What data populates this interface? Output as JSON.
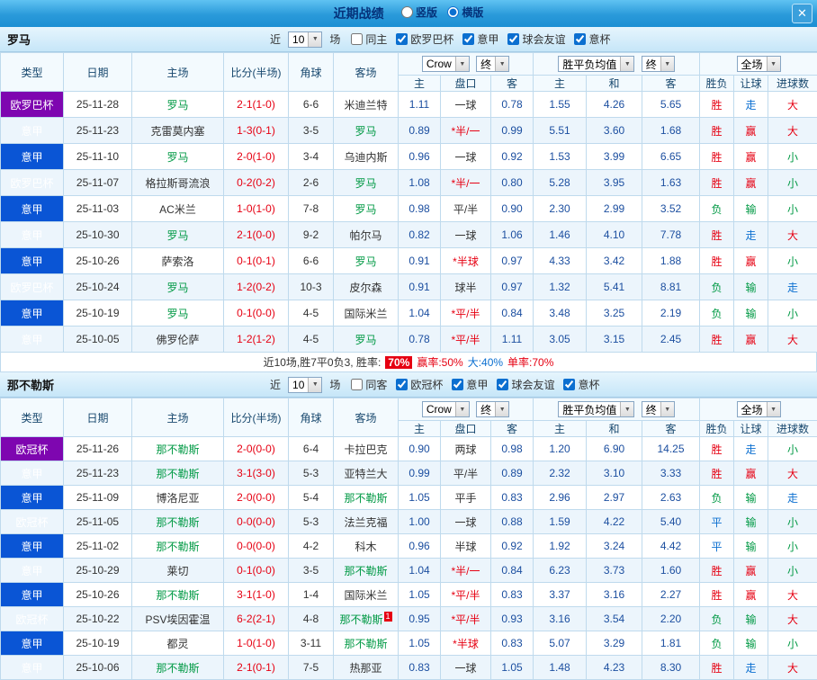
{
  "titlebar": {
    "title": "近期战绩",
    "radio_vertical": "竖版",
    "radio_horizontal": "横版",
    "selected": "横版",
    "close_icon": "✕"
  },
  "table": {
    "col_type": "类型",
    "col_date": "日期",
    "col_home": "主场",
    "col_score": "比分(半场)",
    "col_corner": "角球",
    "col_away": "客场",
    "sub_home": "主",
    "sub_handicap": "盘口",
    "sub_away": "客",
    "sub_avg_home": "主",
    "sub_avg_draw": "和",
    "sub_avg_away": "客",
    "sub_result": "胜负",
    "sub_spread": "让球",
    "sub_goals": "进球数",
    "dd_company": "Crow",
    "dd_final": "终",
    "dd_avg": "胜平负均值",
    "dd_scope": "全场"
  },
  "sections": [
    {
      "team": "罗马",
      "near_label": "近",
      "count": "10",
      "games_label": "场",
      "filters": [
        {
          "label": "同主",
          "checked": false
        },
        {
          "label": "欧罗巴杯",
          "checked": true
        },
        {
          "label": "意甲",
          "checked": true
        },
        {
          "label": "球会友谊",
          "checked": true
        },
        {
          "label": "意杯",
          "checked": true
        }
      ],
      "rows": [
        {
          "comp": "欧罗巴杯",
          "comp_color": "purple",
          "date": "25-11-28",
          "home": "罗马",
          "home_focus": true,
          "score": "2-1(1-0)",
          "corners": "6-6",
          "away": "米迪兰特",
          "odds_home": "1.11",
          "handicap": "一球",
          "odds_away": "0.78",
          "avg_home": "1.55",
          "avg_draw": "4.26",
          "avg_away": "5.65",
          "result": "胜",
          "spread": "走",
          "goals": "大"
        },
        {
          "comp": "意甲",
          "comp_color": "blue",
          "date": "25-11-23",
          "home": "克雷莫内塞",
          "score": "1-3(0-1)",
          "corners": "3-5",
          "away": "罗马",
          "away_focus": true,
          "odds_home": "0.89",
          "handicap": "*半/一",
          "odds_away": "0.99",
          "avg_home": "5.51",
          "avg_draw": "3.60",
          "avg_away": "1.68",
          "result": "胜",
          "spread": "赢",
          "goals": "大"
        },
        {
          "comp": "意甲",
          "comp_color": "blue",
          "date": "25-11-10",
          "home": "罗马",
          "home_focus": true,
          "score": "2-0(1-0)",
          "corners": "3-4",
          "away": "乌迪内斯",
          "odds_home": "0.96",
          "handicap": "一球",
          "odds_away": "0.92",
          "avg_home": "1.53",
          "avg_draw": "3.99",
          "avg_away": "6.65",
          "result": "胜",
          "spread": "赢",
          "goals": "小"
        },
        {
          "comp": "欧罗巴杯",
          "comp_color": "purple",
          "date": "25-11-07",
          "home": "格拉斯哥流浪",
          "score": "0-2(0-2)",
          "corners": "2-6",
          "away": "罗马",
          "away_focus": true,
          "odds_home": "1.08",
          "handicap": "*半/一",
          "odds_away": "0.80",
          "avg_home": "5.28",
          "avg_draw": "3.95",
          "avg_away": "1.63",
          "result": "胜",
          "spread": "赢",
          "goals": "小"
        },
        {
          "comp": "意甲",
          "comp_color": "blue",
          "date": "25-11-03",
          "home": "AC米兰",
          "score": "1-0(1-0)",
          "corners": "7-8",
          "away": "罗马",
          "away_focus": true,
          "odds_home": "0.98",
          "handicap": "平/半",
          "odds_away": "0.90",
          "avg_home": "2.30",
          "avg_draw": "2.99",
          "avg_away": "3.52",
          "result": "负",
          "spread": "输",
          "goals": "小"
        },
        {
          "comp": "意甲",
          "comp_color": "blue",
          "date": "25-10-30",
          "home": "罗马",
          "home_focus": true,
          "score": "2-1(0-0)",
          "corners": "9-2",
          "away": "帕尔马",
          "odds_home": "0.82",
          "handicap": "一球",
          "odds_away": "1.06",
          "avg_home": "1.46",
          "avg_draw": "4.10",
          "avg_away": "7.78",
          "result": "胜",
          "spread": "走",
          "goals": "大"
        },
        {
          "comp": "意甲",
          "comp_color": "blue",
          "date": "25-10-26",
          "home": "萨索洛",
          "score": "0-1(0-1)",
          "corners": "6-6",
          "away": "罗马",
          "away_focus": true,
          "odds_home": "0.91",
          "handicap": "*半球",
          "odds_away": "0.97",
          "avg_home": "4.33",
          "avg_draw": "3.42",
          "avg_away": "1.88",
          "result": "胜",
          "spread": "赢",
          "goals": "小"
        },
        {
          "comp": "欧罗巴杯",
          "comp_color": "purple",
          "date": "25-10-24",
          "home": "罗马",
          "home_focus": true,
          "score": "1-2(0-2)",
          "corners": "10-3",
          "away": "皮尔森",
          "odds_home": "0.91",
          "handicap": "球半",
          "odds_away": "0.97",
          "avg_home": "1.32",
          "avg_draw": "5.41",
          "avg_away": "8.81",
          "result": "负",
          "spread": "输",
          "goals": "走"
        },
        {
          "comp": "意甲",
          "comp_color": "blue",
          "date": "25-10-19",
          "home": "罗马",
          "home_focus": true,
          "score": "0-1(0-0)",
          "corners": "4-5",
          "away": "国际米兰",
          "odds_home": "1.04",
          "handicap": "*平/半",
          "odds_away": "0.84",
          "avg_home": "3.48",
          "avg_draw": "3.25",
          "avg_away": "2.19",
          "result": "负",
          "spread": "输",
          "goals": "小"
        },
        {
          "comp": "意甲",
          "comp_color": "blue",
          "date": "25-10-05",
          "home": "佛罗伦萨",
          "score": "1-2(1-2)",
          "corners": "4-5",
          "away": "罗马",
          "away_focus": true,
          "odds_home": "0.78",
          "handicap": "*平/半",
          "odds_away": "1.11",
          "avg_home": "3.05",
          "avg_draw": "3.15",
          "avg_away": "2.45",
          "result": "胜",
          "spread": "赢",
          "goals": "大"
        }
      ],
      "summary": {
        "prefix": "近10场,胜7平0负3, 胜率:",
        "win_rate": "70%",
        "win_odds_rate": "赢率:50%",
        "big_rate": "大:40%",
        "single_rate": "单率:70%"
      }
    },
    {
      "team": "那不勒斯",
      "near_label": "近",
      "count": "10",
      "games_label": "场",
      "filters": [
        {
          "label": "同客",
          "checked": false
        },
        {
          "label": "欧冠杯",
          "checked": true
        },
        {
          "label": "意甲",
          "checked": true
        },
        {
          "label": "球会友谊",
          "checked": true
        },
        {
          "label": "意杯",
          "checked": true
        }
      ],
      "rows": [
        {
          "comp": "欧冠杯",
          "comp_color": "purple",
          "date": "25-11-26",
          "home": "那不勒斯",
          "home_focus": true,
          "score": "2-0(0-0)",
          "corners": "6-4",
          "away": "卡拉巴克",
          "odds_home": "0.90",
          "handicap": "两球",
          "odds_away": "0.98",
          "avg_home": "1.20",
          "avg_draw": "6.90",
          "avg_away": "14.25",
          "result": "胜",
          "spread": "走",
          "goals": "小"
        },
        {
          "comp": "意甲",
          "comp_color": "blue",
          "date": "25-11-23",
          "home": "那不勒斯",
          "home_focus": true,
          "score": "3-1(3-0)",
          "corners": "5-3",
          "away": "亚特兰大",
          "odds_home": "0.99",
          "handicap": "平/半",
          "odds_away": "0.89",
          "avg_home": "2.32",
          "avg_draw": "3.10",
          "avg_away": "3.33",
          "result": "胜",
          "spread": "赢",
          "goals": "大"
        },
        {
          "comp": "意甲",
          "comp_color": "blue",
          "date": "25-11-09",
          "home": "博洛尼亚",
          "score": "2-0(0-0)",
          "corners": "5-4",
          "away": "那不勒斯",
          "away_focus": true,
          "odds_home": "1.05",
          "handicap": "平手",
          "odds_away": "0.83",
          "avg_home": "2.96",
          "avg_draw": "2.97",
          "avg_away": "2.63",
          "result": "负",
          "spread": "输",
          "goals": "走"
        },
        {
          "comp": "欧冠杯",
          "comp_color": "purple",
          "date": "25-11-05",
          "home": "那不勒斯",
          "home_focus": true,
          "score": "0-0(0-0)",
          "corners": "5-3",
          "away": "法兰克福",
          "odds_home": "1.00",
          "handicap": "一球",
          "odds_away": "0.88",
          "avg_home": "1.59",
          "avg_draw": "4.22",
          "avg_away": "5.40",
          "result": "平",
          "spread": "输",
          "goals": "小"
        },
        {
          "comp": "意甲",
          "comp_color": "blue",
          "date": "25-11-02",
          "home": "那不勒斯",
          "home_focus": true,
          "score": "0-0(0-0)",
          "corners": "4-2",
          "away": "科木",
          "odds_home": "0.96",
          "handicap": "半球",
          "odds_away": "0.92",
          "avg_home": "1.92",
          "avg_draw": "3.24",
          "avg_away": "4.42",
          "result": "平",
          "spread": "输",
          "goals": "小"
        },
        {
          "comp": "意甲",
          "comp_color": "blue",
          "date": "25-10-29",
          "home": "莱切",
          "score": "0-1(0-0)",
          "corners": "3-5",
          "away": "那不勒斯",
          "away_focus": true,
          "odds_home": "1.04",
          "handicap": "*半/一",
          "odds_away": "0.84",
          "avg_home": "6.23",
          "avg_draw": "3.73",
          "avg_away": "1.60",
          "result": "胜",
          "spread": "赢",
          "goals": "小"
        },
        {
          "comp": "意甲",
          "comp_color": "blue",
          "date": "25-10-26",
          "home": "那不勒斯",
          "home_focus": true,
          "score": "3-1(1-0)",
          "corners": "1-4",
          "away": "国际米兰",
          "odds_home": "1.05",
          "handicap": "*平/半",
          "odds_away": "0.83",
          "avg_home": "3.37",
          "avg_draw": "3.16",
          "avg_away": "2.27",
          "result": "胜",
          "spread": "赢",
          "goals": "大"
        },
        {
          "comp": "欧冠杯",
          "comp_color": "purple",
          "date": "25-10-22",
          "home": "PSV埃因霍温",
          "score": "6-2(2-1)",
          "corners": "4-8",
          "away": "那不勒斯",
          "away_focus": true,
          "away_card": "1",
          "odds_home": "0.95",
          "handicap": "*平/半",
          "odds_away": "0.93",
          "avg_home": "3.16",
          "avg_draw": "3.54",
          "avg_away": "2.20",
          "result": "负",
          "spread": "输",
          "goals": "大"
        },
        {
          "comp": "意甲",
          "comp_color": "blue",
          "date": "25-10-19",
          "home": "都灵",
          "score": "1-0(1-0)",
          "corners": "3-11",
          "away": "那不勒斯",
          "away_focus": true,
          "odds_home": "1.05",
          "handicap": "*半球",
          "odds_away": "0.83",
          "avg_home": "5.07",
          "avg_draw": "3.29",
          "avg_away": "1.81",
          "result": "负",
          "spread": "输",
          "goals": "小"
        },
        {
          "comp": "意甲",
          "comp_color": "blue",
          "date": "25-10-06",
          "home": "那不勒斯",
          "home_focus": true,
          "score": "2-1(0-1)",
          "corners": "7-5",
          "away": "热那亚",
          "odds_home": "0.83",
          "handicap": "一球",
          "odds_away": "1.05",
          "avg_home": "1.48",
          "avg_draw": "4.23",
          "avg_away": "8.30",
          "result": "胜",
          "spread": "走",
          "goals": "大"
        }
      ]
    }
  ]
}
